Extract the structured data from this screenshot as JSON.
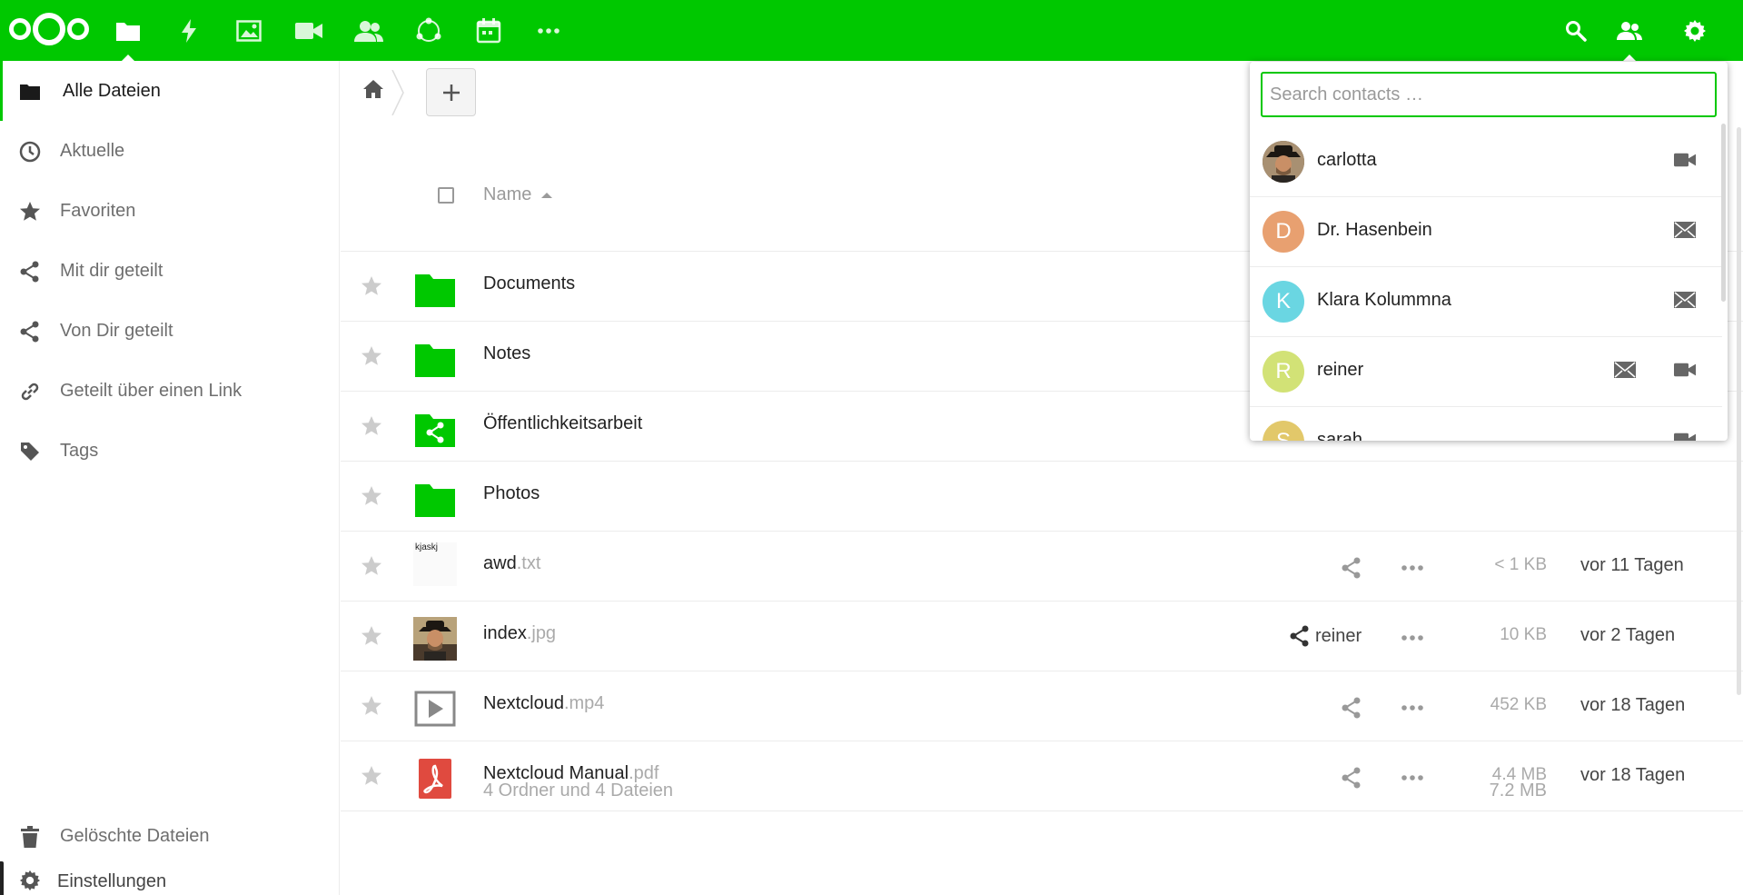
{
  "header": {
    "apps": [
      {
        "icon": "files-icon",
        "active": true
      },
      {
        "icon": "activity-icon"
      },
      {
        "icon": "gallery-icon"
      },
      {
        "icon": "talk-video-icon"
      },
      {
        "icon": "contacts-icon"
      },
      {
        "icon": "circles-icon"
      },
      {
        "icon": "calendar-icon"
      },
      {
        "icon": "more-apps-icon"
      }
    ],
    "right": [
      "search-icon",
      "contacts-menu-icon",
      "settings-icon"
    ],
    "brand_color": "#00c800"
  },
  "sidebar": {
    "items": [
      {
        "label": "Alle Dateien",
        "icon": "folder-icon",
        "active": true
      },
      {
        "label": "Aktuelle",
        "icon": "clock-icon"
      },
      {
        "label": "Favoriten",
        "icon": "star-icon"
      },
      {
        "label": "Mit dir geteilt",
        "icon": "share-icon"
      },
      {
        "label": "Von Dir geteilt",
        "icon": "share-icon"
      },
      {
        "label": "Geteilt über einen Link",
        "icon": "link-icon"
      },
      {
        "label": "Tags",
        "icon": "tag-icon"
      }
    ],
    "deleted_label": "Gelöschte Dateien",
    "settings_label": "Einstellungen"
  },
  "table": {
    "name_header": "Name",
    "rows": [
      {
        "name": "Documents",
        "ext": "",
        "type": "folder",
        "size": "",
        "mtime": ""
      },
      {
        "name": "Notes",
        "ext": "",
        "type": "folder",
        "size": "",
        "mtime": ""
      },
      {
        "name": "Öffentlichkeitsarbeit",
        "ext": "",
        "type": "shared-folder",
        "size": "",
        "mtime": ""
      },
      {
        "name": "Photos",
        "ext": "",
        "type": "folder",
        "size": "",
        "mtime": ""
      },
      {
        "name": "awd",
        "ext": ".txt",
        "type": "text",
        "preview_text": "kjaskj",
        "size": "< 1 KB",
        "mtime": "vor 11 Tagen"
      },
      {
        "name": "index",
        "ext": ".jpg",
        "type": "image",
        "size": "10 KB",
        "mtime": "vor 2 Tagen",
        "shared_with": "reiner"
      },
      {
        "name": "Nextcloud",
        "ext": ".mp4",
        "type": "video",
        "size": "452 KB",
        "mtime": "vor 18 Tagen"
      },
      {
        "name": "Nextcloud Manual",
        "ext": ".pdf",
        "type": "pdf",
        "size": "4.4 MB",
        "mtime": "vor 18 Tagen"
      }
    ],
    "summary": "4 Ordner und 4 Dateien",
    "summary_size": "7.2 MB"
  },
  "contacts": {
    "placeholder": "Search contacts …",
    "items": [
      {
        "name": "carlotta",
        "initial": "",
        "color": "#5a4a3a",
        "actions": [
          "video-icon"
        ]
      },
      {
        "name": "Dr. Hasenbein",
        "initial": "D",
        "color": "#e8a070",
        "actions": [
          "mail-icon"
        ]
      },
      {
        "name": "Klara Kolummna",
        "initial": "K",
        "color": "#6ad6e2",
        "actions": [
          "mail-icon"
        ]
      },
      {
        "name": "reiner",
        "initial": "R",
        "color": "#d2e276",
        "actions": [
          "mail-icon",
          "video-icon"
        ]
      },
      {
        "name": "sarah",
        "initial": "S",
        "color": "#e2c86a",
        "actions": [
          "video-icon"
        ]
      }
    ]
  }
}
